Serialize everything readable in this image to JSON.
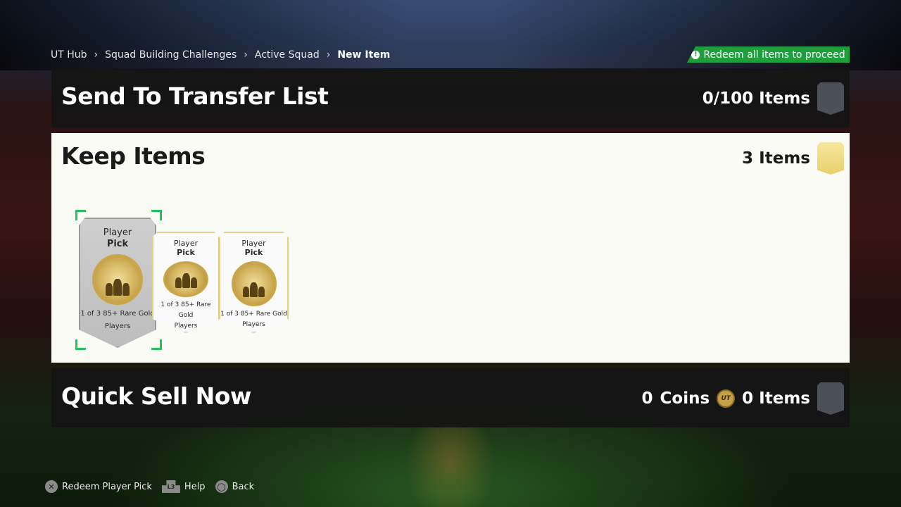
{
  "breadcrumb": [
    {
      "label": "UT Hub"
    },
    {
      "label": "Squad Building Challenges"
    },
    {
      "label": "Active Squad"
    },
    {
      "label": "New Item"
    }
  ],
  "redeem_banner": {
    "text": "Redeem all items to proceed",
    "icon": "info-icon"
  },
  "transfer_panel": {
    "title": "Send To Transfer List",
    "count": "0/100 Items",
    "icon": "gray-shield-icon"
  },
  "keep_panel": {
    "title": "Keep Items",
    "count": "3 Items",
    "icon": "gold-shield-icon",
    "packs": [
      {
        "line1": "Player",
        "line2": "Pick",
        "desc_line1": "1 of 3 85+ Rare Gold",
        "desc_line2": "Players",
        "selected": true
      },
      {
        "line1": "Player",
        "line2": "Pick",
        "desc_line1": "1 of 3 85+ Rare Gold",
        "desc_line2": "Players",
        "selected": false
      },
      {
        "line1": "Player",
        "line2": "Pick",
        "desc_line1": "1 of 3 85+ Rare Gold",
        "desc_line2": "Players",
        "selected": false
      }
    ]
  },
  "quicksell_panel": {
    "title": "Quick Sell Now",
    "coins_value": "0",
    "coins_label": "Coins",
    "coin_icon_text": "UT",
    "count": "0 Items",
    "icon": "gray-shield-icon"
  },
  "controls": [
    {
      "glyph": "✕",
      "label": "Redeem Player Pick",
      "icon": "cross-button-icon"
    },
    {
      "glyph": "L3",
      "label": "Help",
      "icon": "left-stick-icon"
    },
    {
      "glyph": "◯",
      "label": "Back",
      "icon": "circle-button-icon"
    }
  ],
  "colors": {
    "accent_green": "#1e9e3c",
    "selection": "#21c45a",
    "gold": "#e9cf6a"
  }
}
